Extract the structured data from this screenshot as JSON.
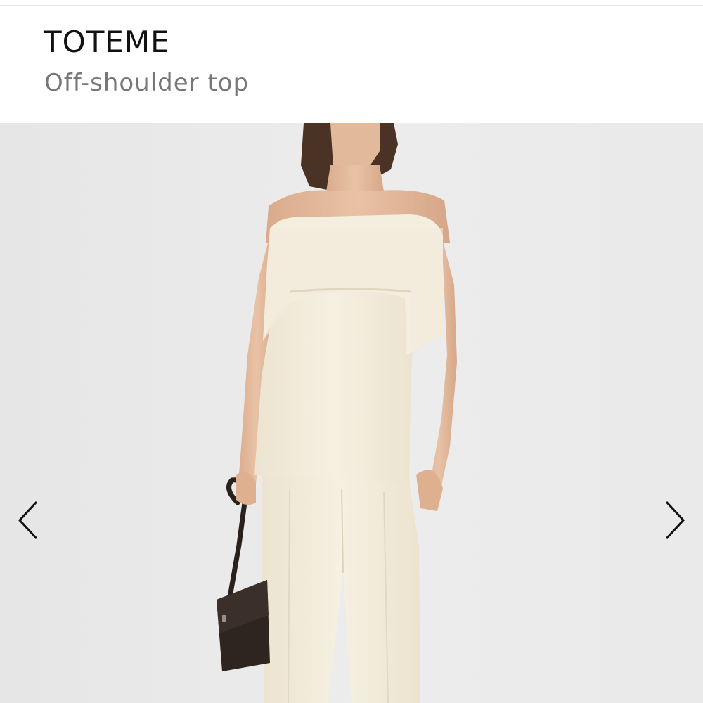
{
  "header": {
    "brand": "TOTEME",
    "product_name": "Off-shoulder top"
  },
  "gallery": {
    "image_alt": "Model wearing cream off-shoulder top with cream trousers, holding a dark brown bag",
    "prev_icon": "chevron-left-icon",
    "next_icon": "chevron-right-icon"
  },
  "colors": {
    "background": "#ebebeb",
    "garment": "#f2ecdc",
    "skin": "#e2b89a",
    "hair": "#4a3324",
    "bag": "#2e2520",
    "text_primary": "#111111",
    "text_secondary": "#777777"
  }
}
